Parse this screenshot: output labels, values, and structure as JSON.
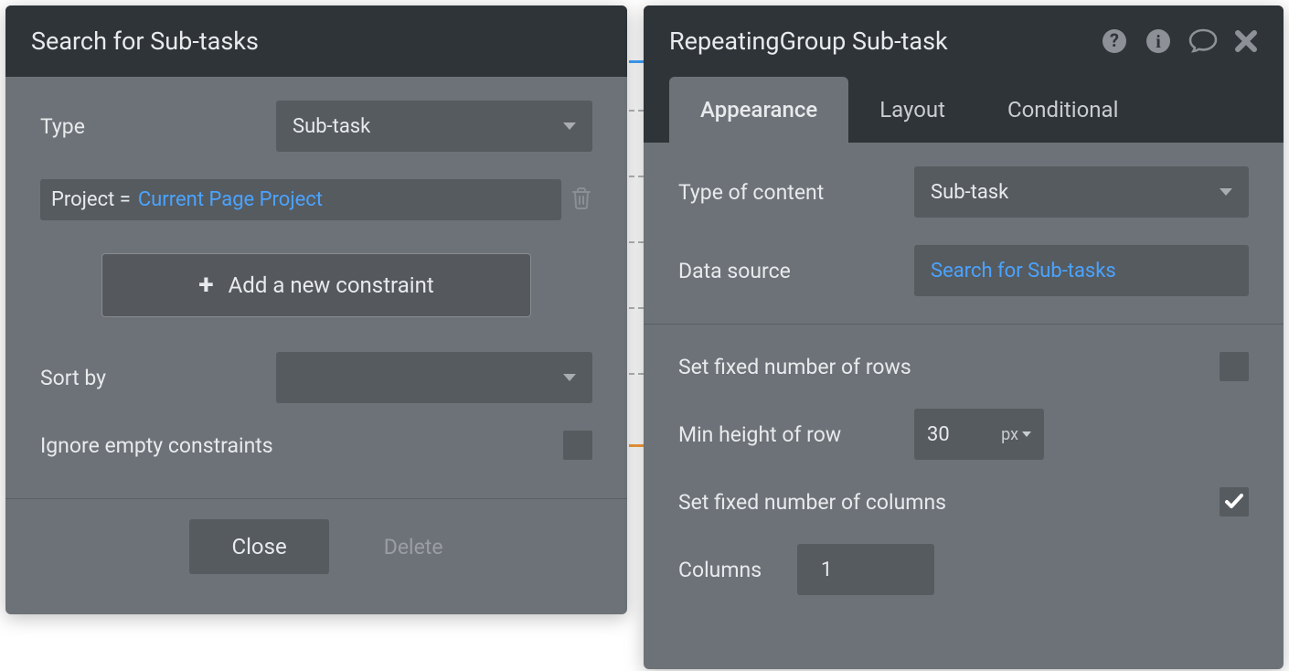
{
  "left_panel": {
    "title": "Search for Sub-tasks",
    "type_label": "Type",
    "type_value": "Sub-task",
    "constraint_prefix": "Project = ",
    "constraint_value": "Current Page Project",
    "add_constraint_label": "Add a new constraint",
    "sort_by_label": "Sort by",
    "sort_by_value": "",
    "ignore_empty_label": "Ignore empty constraints",
    "ignore_empty_checked": false,
    "close_label": "Close",
    "delete_label": "Delete"
  },
  "right_panel": {
    "title": "RepeatingGroup Sub-task",
    "tabs": {
      "appearance": "Appearance",
      "layout": "Layout",
      "conditional": "Conditional"
    },
    "active_tab": "appearance",
    "type_of_content_label": "Type of content",
    "type_of_content_value": "Sub-task",
    "data_source_label": "Data source",
    "data_source_value": "Search for Sub-tasks",
    "fixed_rows_label": "Set fixed number of rows",
    "fixed_rows_checked": false,
    "min_height_label": "Min height of row",
    "min_height_value": "30",
    "min_height_unit": "px",
    "fixed_cols_label": "Set fixed number of columns",
    "fixed_cols_checked": true,
    "columns_label": "Columns",
    "columns_value": "1"
  }
}
